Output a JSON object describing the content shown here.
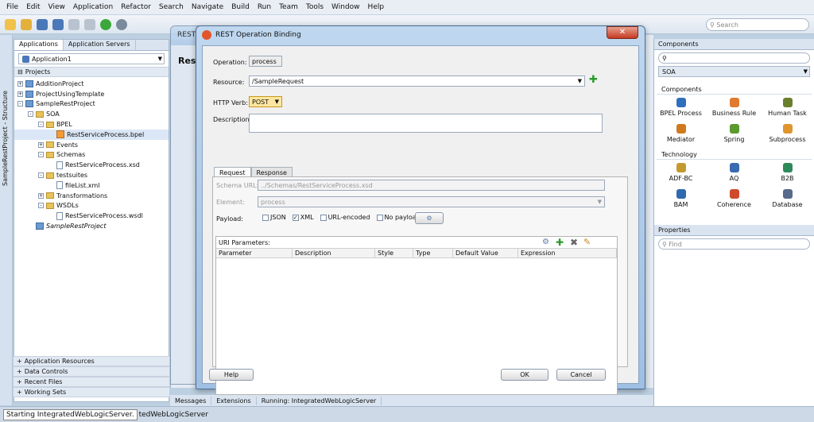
{
  "menu": [
    "File",
    "Edit",
    "View",
    "Application",
    "Refactor",
    "Search",
    "Navigate",
    "Build",
    "Run",
    "Team",
    "Tools",
    "Window",
    "Help"
  ],
  "toolbar": {
    "search_placeholder": "Search"
  },
  "left_strip": {
    "label": "SampleRestProject - Structure"
  },
  "app_panel": {
    "tabs": [
      "Applications",
      "Application Servers"
    ],
    "app_selector": "Application1",
    "projects_header": "Projects",
    "tree": [
      {
        "label": "AdditionProject",
        "depth": 0,
        "kind": "proj",
        "exp": "+"
      },
      {
        "label": "ProjectUsingTemplate",
        "depth": 0,
        "kind": "proj",
        "exp": "+"
      },
      {
        "label": "SampleRestProject",
        "depth": 0,
        "kind": "proj",
        "exp": "-"
      },
      {
        "label": "SOA",
        "depth": 1,
        "kind": "folder",
        "exp": "-"
      },
      {
        "label": "BPEL",
        "depth": 2,
        "kind": "folder",
        "exp": "-"
      },
      {
        "label": "RestServiceProcess.bpel",
        "depth": 3,
        "kind": "bpel",
        "exp": "",
        "selected": true
      },
      {
        "label": "Events",
        "depth": 2,
        "kind": "folder",
        "exp": "+"
      },
      {
        "label": "Schemas",
        "depth": 2,
        "kind": "folder",
        "exp": "-"
      },
      {
        "label": "RestServiceProcess.xsd",
        "depth": 3,
        "kind": "file",
        "exp": ""
      },
      {
        "label": "testsuites",
        "depth": 2,
        "kind": "folder",
        "exp": "-"
      },
      {
        "label": "fileList.xml",
        "depth": 3,
        "kind": "file",
        "exp": ""
      },
      {
        "label": "Transformations",
        "depth": 2,
        "kind": "folder",
        "exp": "+"
      },
      {
        "label": "WSDLs",
        "depth": 2,
        "kind": "folder",
        "exp": "-"
      },
      {
        "label": "RestServiceProcess.wsdl",
        "depth": 3,
        "kind": "file",
        "exp": ""
      },
      {
        "label": "SampleRestProject",
        "depth": 1,
        "kind": "proj",
        "exp": "",
        "italic": true
      }
    ],
    "bottom_sections": [
      "Application Resources",
      "Data Controls",
      "Recent Files",
      "Working Sets"
    ]
  },
  "bg_dialog": {
    "title_prefix": "REST",
    "resource_label": "Reso"
  },
  "dialog": {
    "title": "REST Operation Binding",
    "close": "✕",
    "operation_label": "Operation:",
    "operation_value": "process",
    "resource_label": "Resource:",
    "resource_value": "/SampleRequest",
    "verb_label": "HTTP Verb:",
    "verb_value": "POST",
    "description_label": "Description:",
    "tabs": [
      "Request",
      "Response"
    ],
    "schema_url_label": "Schema URL:",
    "schema_url_value": "../Schemas/RestServiceProcess.xsd",
    "element_label": "Element:",
    "element_value": "process",
    "payload_label": "Payload:",
    "payload_options": [
      {
        "label": "JSON",
        "checked": false
      },
      {
        "label": "XML",
        "checked": true
      },
      {
        "label": "URL-encoded",
        "checked": false
      },
      {
        "label": "No payload",
        "checked": false
      }
    ],
    "uri_params_label": "URI Parameters:",
    "columns": [
      "Parameter",
      "Description",
      "Style",
      "Type",
      "Default Value",
      "Expression"
    ],
    "help_button": "Help",
    "ok_button": "OK",
    "cancel_button": "Cancel"
  },
  "right_panel": {
    "components_title": "Components",
    "palette_selected": "SOA",
    "components_section": "Components",
    "components": [
      "BPEL Process",
      "Business Rule",
      "Human Task",
      "Mediator",
      "Spring",
      "Subprocess"
    ],
    "technology_section": "Technology",
    "technology": [
      "ADF-BC",
      "AQ",
      "B2B",
      "BAM",
      "Coherence",
      "Database"
    ],
    "properties_title": "Properties",
    "properties_find": "Find"
  },
  "bottom_tabs": [
    "Messages",
    "Extensions",
    "Running: IntegratedWebLogicServer"
  ],
  "status": {
    "text": "Starting IntegratedWebLogicServer.",
    "trail": "tedWebLogicServer"
  },
  "colors": {
    "accent": "#2b9a2b",
    "title_bar": "#a9c6e6"
  }
}
